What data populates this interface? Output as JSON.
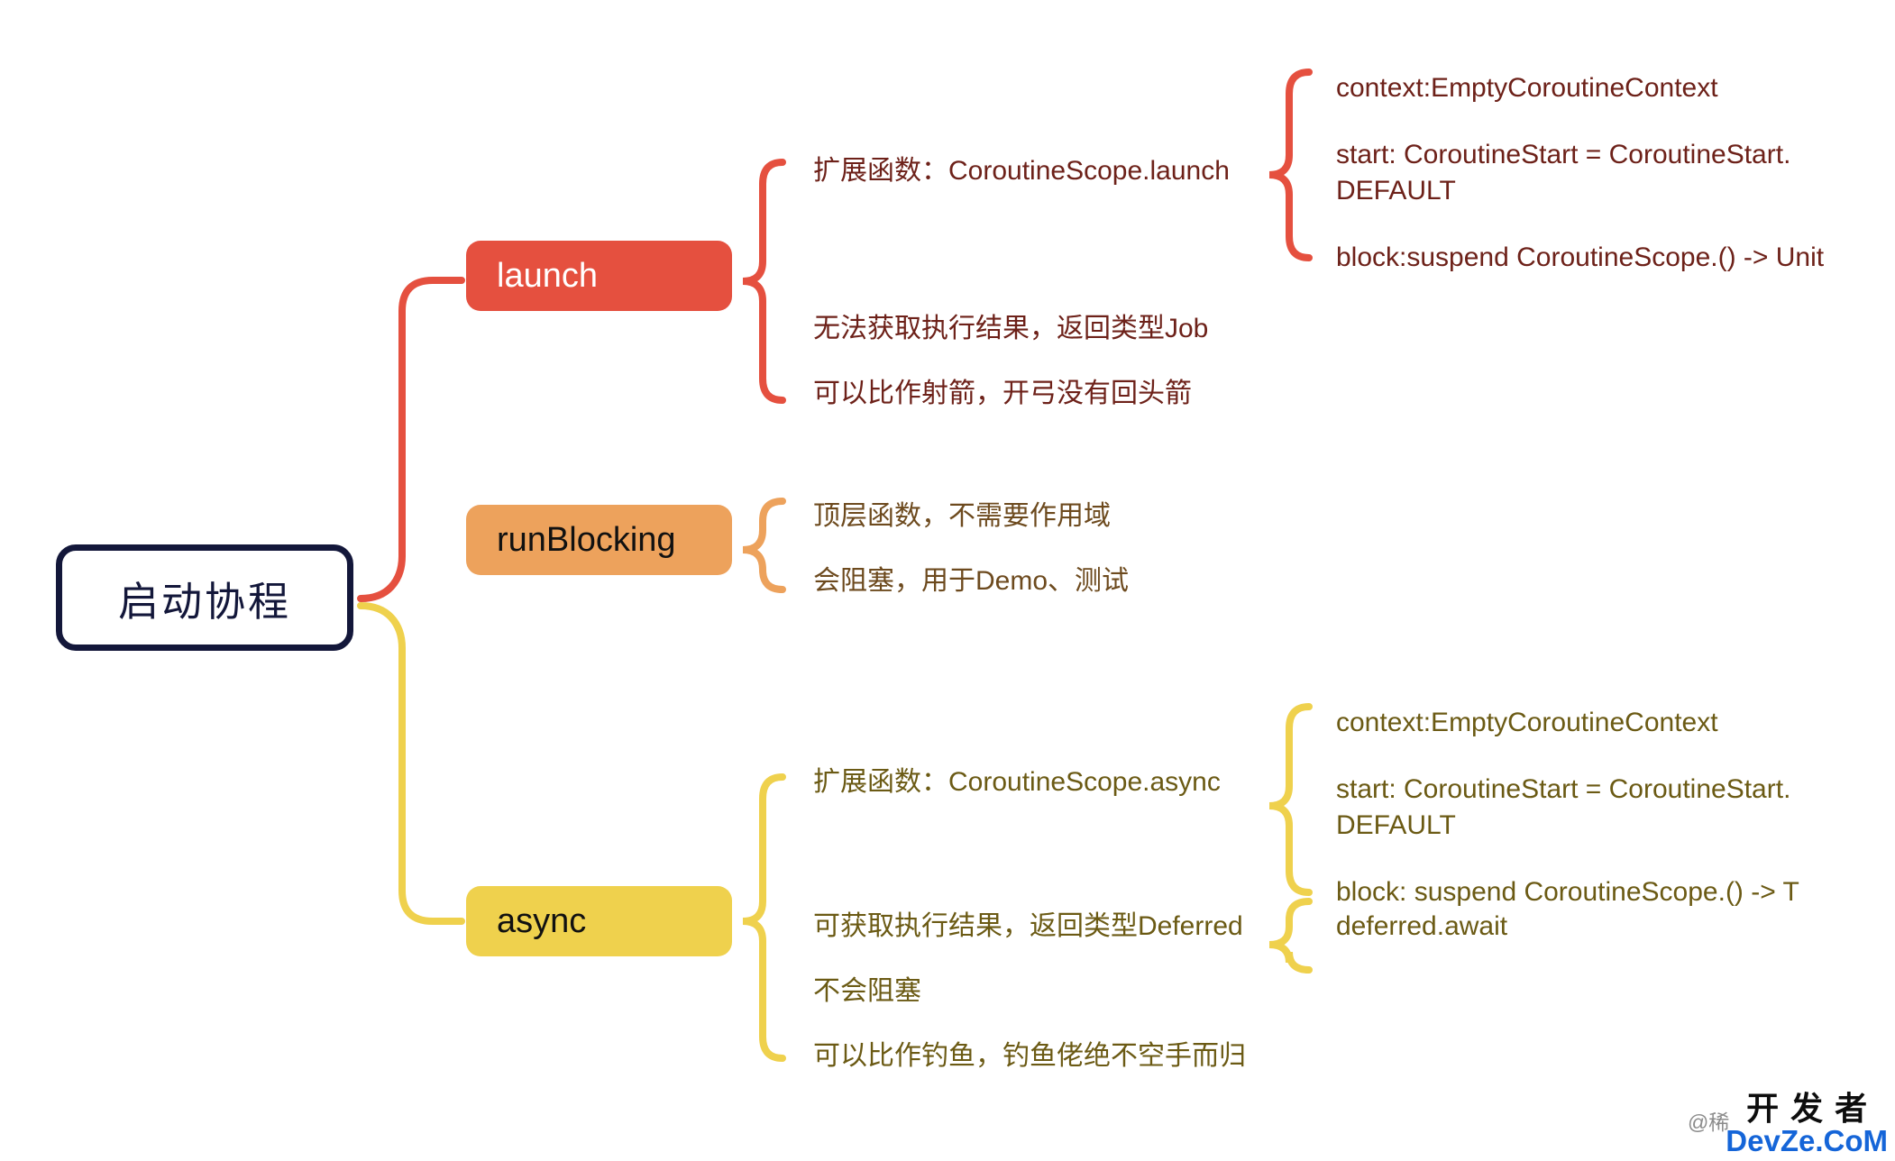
{
  "diagram": {
    "title": "启动协程",
    "type": "mindmap",
    "root": {
      "label": "启动协程",
      "border_color": "#13173a",
      "text_color": "#13173a"
    },
    "branches": [
      {
        "id": "launch",
        "label": "launch",
        "fill_color": "#e5503f",
        "label_color": "#ffffff",
        "text_color": "#6d2119",
        "children": [
          {
            "label": "扩展函数：CoroutineScope.launch",
            "children": [
              {
                "label": "context:EmptyCoroutineContext"
              },
              {
                "label": "start: CoroutineStart = CoroutineStart.\nDEFAULT"
              },
              {
                "label": "block:suspend CoroutineScope.() -> Unit"
              }
            ]
          },
          {
            "label": "无法获取执行结果，返回类型Job",
            "children": []
          },
          {
            "label": "可以比作射箭，开弓没有回头箭",
            "children": []
          }
        ]
      },
      {
        "id": "runBlocking",
        "label": "runBlocking",
        "fill_color": "#eda25c",
        "label_color": "#111111",
        "text_color": "#6d4a1e",
        "children": [
          {
            "label": "顶层函数，不需要作用域",
            "children": []
          },
          {
            "label": "会阻塞，用于Demo、测试",
            "children": []
          }
        ]
      },
      {
        "id": "async",
        "label": "async",
        "fill_color": "#efd14d",
        "label_color": "#111111",
        "text_color": "#6b5a14",
        "children": [
          {
            "label": "扩展函数：CoroutineScope.async",
            "children": [
              {
                "label": "context:EmptyCoroutineContext"
              },
              {
                "label": "start: CoroutineStart = CoroutineStart.\nDEFAULT"
              },
              {
                "label": "block: suspend CoroutineScope.() -> T"
              }
            ]
          },
          {
            "label": "可获取执行结果，返回类型Deferred",
            "children": [
              {
                "label": "deferred.await"
              }
            ]
          },
          {
            "label": "不会阻塞",
            "children": []
          },
          {
            "label": "可以比作钓鱼，钓鱼佬绝不空手而归",
            "children": []
          }
        ]
      }
    ]
  },
  "watermark": {
    "prefix": "@稀",
    "cn": "开发者",
    "en": "DevZe.CoM",
    "cn_color": "#0d0d0d",
    "en_color": "#1565d8",
    "prefix_color": "#8b8b8b"
  }
}
